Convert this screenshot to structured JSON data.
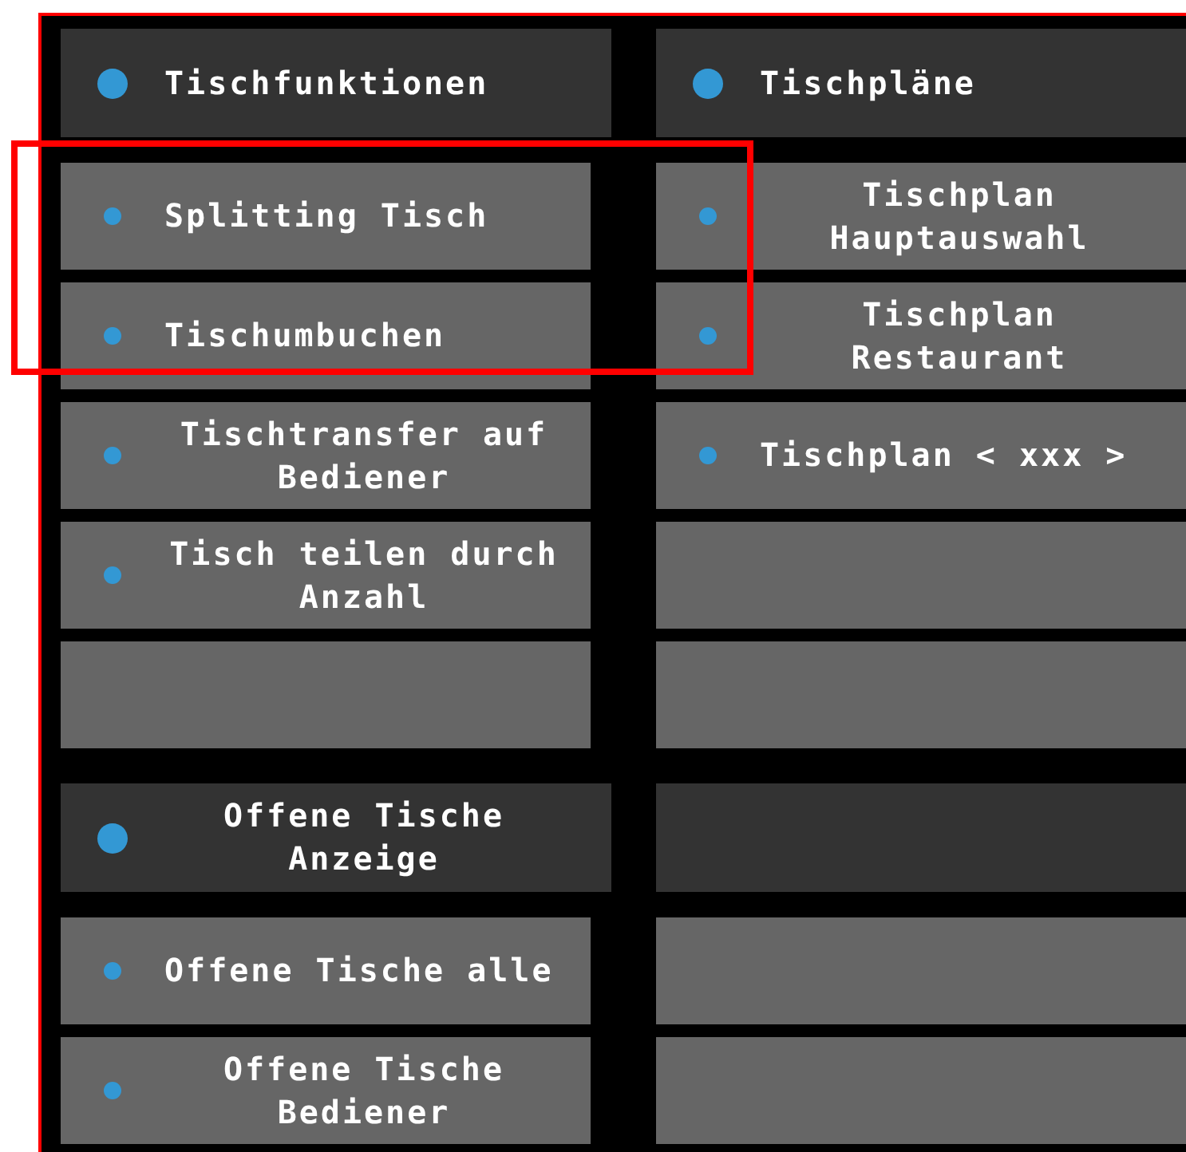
{
  "columns": [
    {
      "cells": [
        {
          "kind": "header",
          "label": "Tischfunktionen"
        },
        {
          "kind": "item",
          "label": "Splitting Tisch"
        },
        {
          "kind": "item",
          "label": "Tischumbuchen"
        },
        {
          "kind": "item",
          "label": "Tischtransfer auf Bediener"
        },
        {
          "kind": "item",
          "label": "Tisch teilen durch Anzahl"
        },
        {
          "kind": "item"
        },
        {
          "kind": "header",
          "label": "Offene Tische Anzeige"
        },
        {
          "kind": "item",
          "label": "Offene Tische alle"
        },
        {
          "kind": "item",
          "label": "Offene Tische Bediener"
        }
      ]
    },
    {
      "cells": [
        {
          "kind": "header",
          "label": "Tischpläne"
        },
        {
          "kind": "item",
          "label": "Tischplan Hauptauswahl"
        },
        {
          "kind": "item",
          "label": "Tischplan Restaurant"
        },
        {
          "kind": "item",
          "label": "Tischplan < xxx >"
        },
        {
          "kind": "item"
        },
        {
          "kind": "item"
        },
        {
          "kind": "header"
        },
        {
          "kind": "item"
        },
        {
          "kind": "item"
        }
      ]
    }
  ],
  "annotation": {
    "shown": true
  }
}
